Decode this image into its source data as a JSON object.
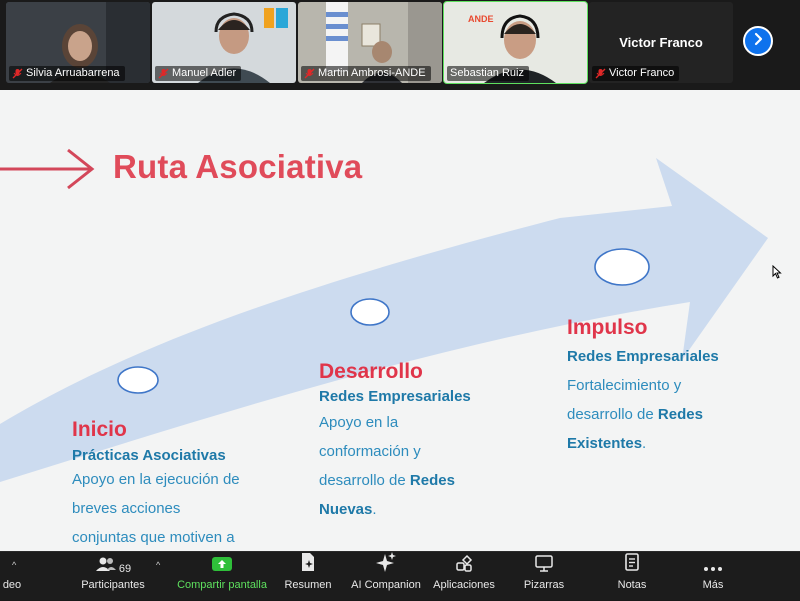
{
  "participants": [
    {
      "name": "Silvia Arruabarrena",
      "muted": true
    },
    {
      "name": "Manuel Adler",
      "muted": true
    },
    {
      "name": "Martin Ambrosi-ANDE",
      "muted": true
    },
    {
      "name": "Sebastian Ruiz",
      "muted": false,
      "active": true
    },
    {
      "name": "Victor Franco",
      "muted": true,
      "video_off": true
    }
  ],
  "next_page_icon": "chevron-right-icon",
  "slide": {
    "title": "Ruta Asociativa",
    "stages": [
      {
        "heading": "Inicio",
        "subheading": "Prácticas Asociativas",
        "body": [
          "Apoyo en la ejecución de",
          "breves acciones",
          "conjuntas que motiven a"
        ]
      },
      {
        "heading": "Desarrollo",
        "subheading": "Redes Empresariales",
        "body_1": "Apoyo en la",
        "body_2": "conformación y",
        "body_3": "desarrollo de ",
        "body_3_bold": "Redes",
        "body_4_bold": "Nuevas",
        "body_4": "."
      },
      {
        "heading": "Impulso",
        "subheading": "Redes Empresariales",
        "body_1": "Fortalecimiento y",
        "body_2": "desarrollo de ",
        "body_2_bold": "Redes",
        "body_3_bold": "Existentes",
        "body_3": "."
      }
    ]
  },
  "toolbar": {
    "video_label": "deo",
    "participants_label": "Participantes",
    "participants_count": "69",
    "share_label": "Compartir pantalla",
    "summary_label": "Resumen",
    "ai_label": "AI Companion",
    "apps_label": "Aplicaciones",
    "whiteboards_label": "Pizarras",
    "notes_label": "Notas",
    "more_label": "Más"
  },
  "colors": {
    "accent_red": "#e04b5a",
    "accent_blue": "#1e79a8",
    "share_green": "#5ee05e",
    "zoom_blue": "#0e72ed"
  }
}
